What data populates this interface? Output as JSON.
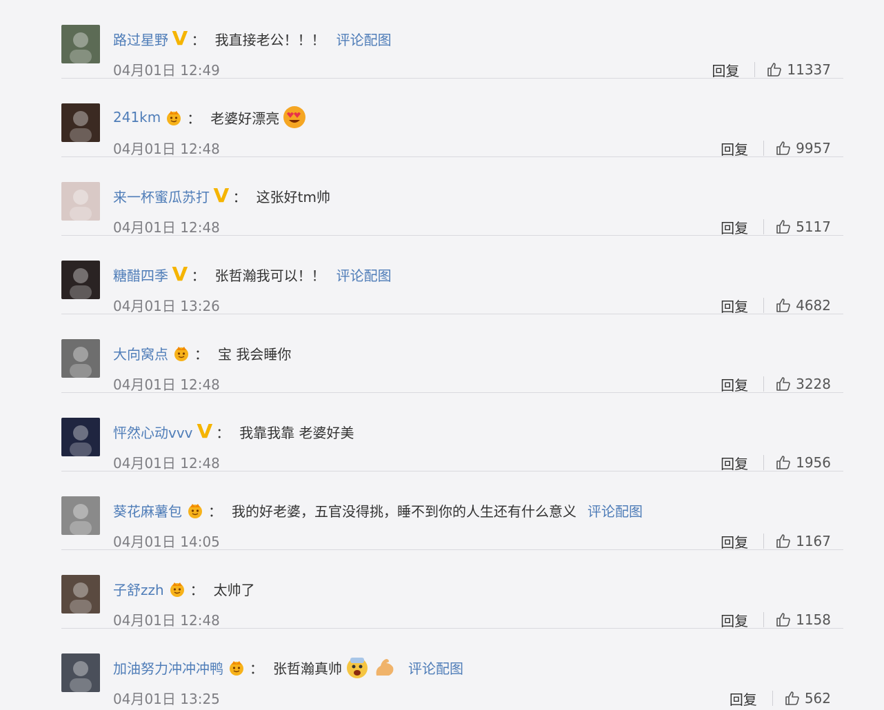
{
  "colors": {
    "accent": "#4f7db8",
    "vip": "#f5b400",
    "meta": "#7d7d82"
  },
  "reply_label": "回复",
  "pic_link_label": "评论配图",
  "comments": [
    {
      "user": "路过星野",
      "badge": "v",
      "text": "我直接老公！！！",
      "has_pic_link": true,
      "time": "04月01日 12:49",
      "likes": "11337",
      "emojis": []
    },
    {
      "user": "241km",
      "badge": "crown",
      "text": "老婆好漂亮",
      "has_pic_link": false,
      "time": "04月01日 12:48",
      "likes": "9957",
      "emojis": [
        "heart-eyes-emoji"
      ]
    },
    {
      "user": "来一杯蜜瓜苏打",
      "badge": "v",
      "text": "这张好tm帅",
      "has_pic_link": false,
      "time": "04月01日 12:48",
      "likes": "5117",
      "emojis": []
    },
    {
      "user": "糖醋四季",
      "badge": "v",
      "text": "张哲瀚我可以！！",
      "has_pic_link": true,
      "time": "04月01日 13:26",
      "likes": "4682",
      "emojis": []
    },
    {
      "user": "大向窝点",
      "badge": "crown",
      "text": "宝 我会睡你",
      "has_pic_link": false,
      "time": "04月01日 12:48",
      "likes": "3228",
      "emojis": []
    },
    {
      "user": "怦然心动vvv",
      "badge": "v",
      "text": "我靠我靠 老婆好美",
      "has_pic_link": false,
      "time": "04月01日 12:48",
      "likes": "1956",
      "emojis": []
    },
    {
      "user": "葵花麻薯包",
      "badge": "crown",
      "text": "我的好老婆，五官没得挑，睡不到你的人生还有什么意义",
      "has_pic_link": true,
      "time": "04月01日 14:05",
      "likes": "1167",
      "emojis": []
    },
    {
      "user": "子舒zzh",
      "badge": "crown",
      "text": "太帅了",
      "has_pic_link": false,
      "time": "04月01日 12:48",
      "likes": "1158",
      "emojis": []
    },
    {
      "user": "加油努力冲冲冲鸭",
      "badge": "crown",
      "text": "张哲瀚真帅",
      "has_pic_link": true,
      "time": "04月01日 13:25",
      "likes": "562",
      "emojis": [
        "scream-emoji",
        "muscle-emoji"
      ]
    }
  ]
}
